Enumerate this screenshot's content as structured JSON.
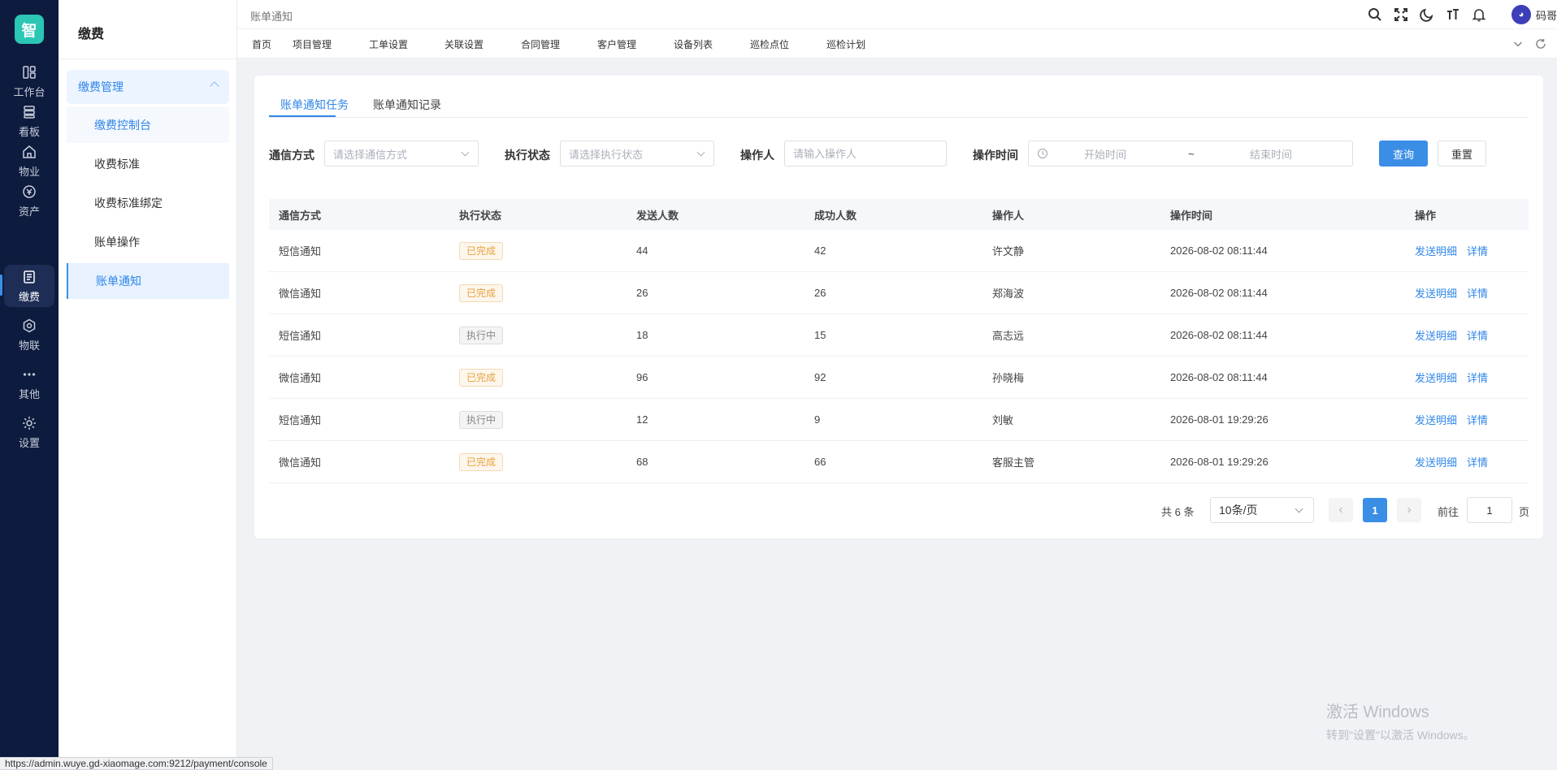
{
  "rail": {
    "logo": "智",
    "items": [
      {
        "label": "工作台",
        "icon": "dashboard-icon"
      },
      {
        "label": "看板",
        "icon": "board-icon"
      },
      {
        "label": "物业",
        "icon": "home-icon"
      },
      {
        "label": "资产",
        "icon": "asset-icon"
      },
      {
        "label": "缴费",
        "icon": "bill-icon"
      },
      {
        "label": "物联",
        "icon": "iot-icon"
      },
      {
        "label": "其他",
        "icon": "more-icon"
      },
      {
        "label": "设置",
        "icon": "gear-icon"
      }
    ],
    "active": 4
  },
  "submenu": {
    "title": "缴费",
    "group": "缴费管理",
    "items": [
      "缴费控制台",
      "收费标准",
      "收费标准绑定",
      "账单操作",
      "账单通知"
    ]
  },
  "topbar": {
    "breadcrumb": "账单通知",
    "user": "码哥"
  },
  "nav_tabs": [
    "首页",
    "项目管理",
    "工单设置",
    "关联设置",
    "合同管理",
    "客户管理",
    "设备列表",
    "巡检点位",
    "巡检计划"
  ],
  "tabs": [
    "账单通知任务",
    "账单通知记录"
  ],
  "filters": {
    "channel_label": "通信方式",
    "channel_placeholder": "请选择通信方式",
    "status_label": "执行状态",
    "status_placeholder": "请选择执行状态",
    "operator_label": "操作人",
    "operator_placeholder": "请输入操作人",
    "time_label": "操作时间",
    "start_placeholder": "开始时间",
    "range_sep": "~",
    "end_placeholder": "结束时间",
    "query": "查询",
    "reset": "重置"
  },
  "table": {
    "columns": [
      "通信方式",
      "执行状态",
      "发送人数",
      "成功人数",
      "操作人",
      "操作时间",
      "操作"
    ],
    "rows": [
      {
        "channel": "短信通知",
        "status": "已完成",
        "status_type": "done",
        "sent": "44",
        "success": "42",
        "operator": "许文静",
        "time": "2026-08-02 08:11:44"
      },
      {
        "channel": "微信通知",
        "status": "已完成",
        "status_type": "done",
        "sent": "26",
        "success": "26",
        "operator": "郑海波",
        "time": "2026-08-02 08:11:44"
      },
      {
        "channel": "短信通知",
        "status": "执行中",
        "status_type": "run",
        "sent": "18",
        "success": "15",
        "operator": "高志远",
        "time": "2026-08-02 08:11:44"
      },
      {
        "channel": "微信通知",
        "status": "已完成",
        "status_type": "done",
        "sent": "96",
        "success": "92",
        "operator": "孙晓梅",
        "time": "2026-08-02 08:11:44"
      },
      {
        "channel": "短信通知",
        "status": "执行中",
        "status_type": "run",
        "sent": "12",
        "success": "9",
        "operator": "刘敏",
        "time": "2026-08-01 19:29:26"
      },
      {
        "channel": "微信通知",
        "status": "已完成",
        "status_type": "done",
        "sent": "68",
        "success": "66",
        "operator": "客服主管",
        "time": "2026-08-01 19:29:26"
      }
    ],
    "action_detail_send": "发送明细",
    "action_detail": "详情"
  },
  "pagination": {
    "total": "共 6 条",
    "page_size": "10条/页",
    "current": "1",
    "goto_label": "前往",
    "goto_value": "1",
    "goto_suffix": "页"
  },
  "watermark": {
    "line1": "激活 Windows",
    "line2": "转到\"设置\"以激活 Windows。"
  },
  "statusbar": "https://admin.wuye.gd-xiaomage.com:9212/payment/console",
  "colors": {
    "accent": "#3a8ee6",
    "rail_bg": "#0d1b3e",
    "logo_bg": "#2bc7b4",
    "tag_done": "#e6a23c"
  }
}
